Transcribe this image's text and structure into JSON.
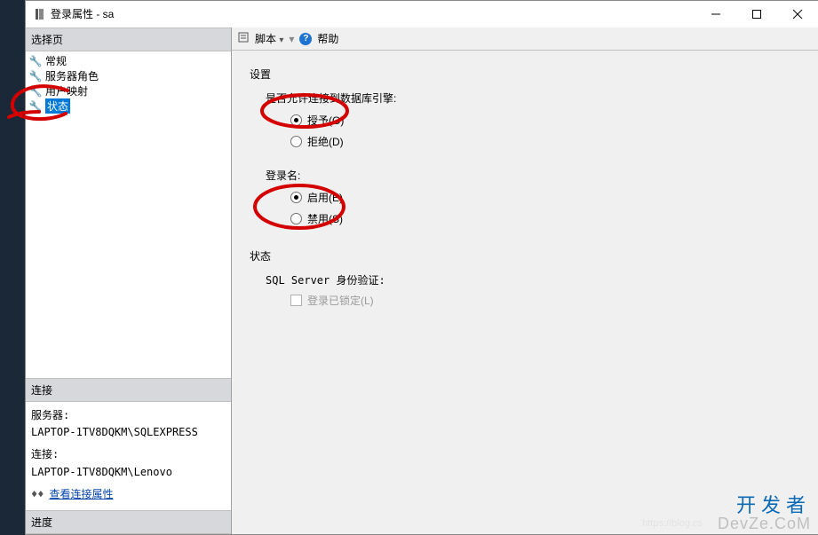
{
  "window": {
    "title": "登录属性 - sa"
  },
  "sidebar": {
    "select_page_header": "选择页",
    "items": [
      {
        "label": "常规"
      },
      {
        "label": "服务器角色"
      },
      {
        "label": "用户映射"
      },
      {
        "label": "状态"
      }
    ],
    "connection_header": "连接",
    "server_label": "服务器:",
    "server_value": "LAPTOP-1TV8DQKM\\SQLEXPRESS",
    "conn_label": "连接:",
    "conn_value": "LAPTOP-1TV8DQKM\\Lenovo",
    "view_props_link": "查看连接属性",
    "progress_header": "进度"
  },
  "toolbar": {
    "script_label": "脚本",
    "help_label": "帮助"
  },
  "content": {
    "settings_title": "设置",
    "permission_label": "是否允许连接到数据库引擎:",
    "permission_options": {
      "grant": "授予(G)",
      "deny": "拒绝(D)"
    },
    "login_label": "登录名:",
    "login_options": {
      "enabled": "启用(E)",
      "disabled": "禁用(S)"
    },
    "status_title": "状态",
    "auth_label": "SQL Server 身份验证:",
    "locked_label": "登录已锁定(L)"
  },
  "watermark": {
    "line1": "开发者",
    "line2": "DevZe.CoM",
    "faint": "https://blog.cs"
  }
}
